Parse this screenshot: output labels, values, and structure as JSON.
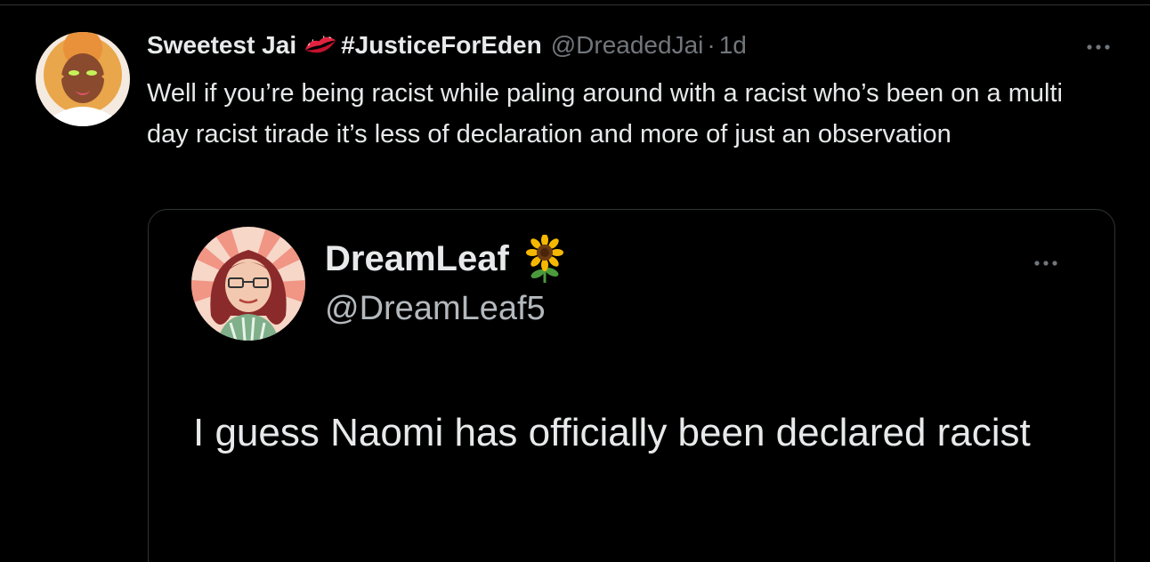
{
  "tweet": {
    "author": {
      "display_name": "Sweetest Jai",
      "emoji_icon": "kiss-mark-icon",
      "hashtag": "#JusticeForEden",
      "handle": "@DreadedJai",
      "separator": "·",
      "time": "1d"
    },
    "text": "Well if you’re being racist while paling around with a racist who’s been on a multi day racist tirade it’s less of declaration and more of just an observation",
    "menu_icon": "more-horizontal-icon"
  },
  "quoted_tweet": {
    "author": {
      "display_name": "DreamLeaf",
      "emoji_icon": "sunflower-icon",
      "handle": "@DreamLeaf5"
    },
    "text": "I guess Naomi has officially been declared racist",
    "menu_icon": "more-horizontal-icon"
  },
  "colors": {
    "background": "#000000",
    "text_primary": "#e7e9ea",
    "text_secondary": "#71767b",
    "border": "#2f3336"
  }
}
